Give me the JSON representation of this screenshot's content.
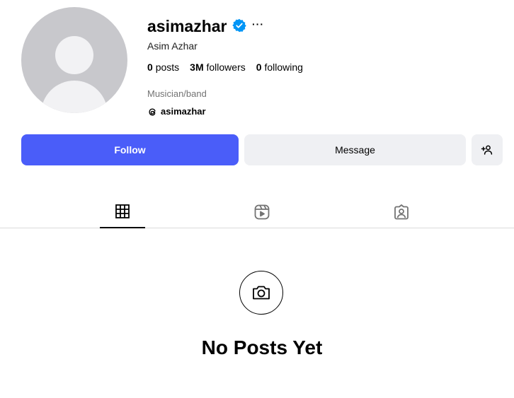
{
  "profile": {
    "username": "asimazhar",
    "full_name": "Asim Azhar",
    "category": "Musician/band",
    "threads_handle": "asimazhar",
    "verified": true
  },
  "stats": [
    {
      "value": "0",
      "label": "posts"
    },
    {
      "value": "3M",
      "label": "followers"
    },
    {
      "value": "0",
      "label": "following"
    }
  ],
  "actions": {
    "follow_label": "Follow",
    "message_label": "Message",
    "more_label": "···"
  },
  "tabs": [
    {
      "icon": "grid-icon",
      "active": true
    },
    {
      "icon": "reels-icon",
      "active": false
    },
    {
      "icon": "tagged-icon",
      "active": false
    }
  ],
  "empty_state": {
    "icon": "camera-icon",
    "title": "No Posts Yet"
  },
  "colors": {
    "primary": "#4a5df9",
    "secondary_button": "#eff0f3",
    "verified_badge": "#0095f6",
    "muted_text": "#737373"
  }
}
